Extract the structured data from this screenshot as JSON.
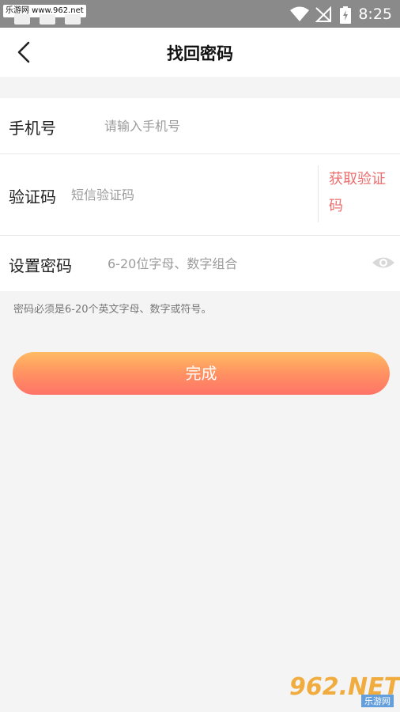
{
  "status_bar": {
    "watermark": "乐游网 www.962.net",
    "time": "8:25"
  },
  "header": {
    "title": "找回密码"
  },
  "form": {
    "phone": {
      "label": "手机号",
      "placeholder": "请输入手机号",
      "value": ""
    },
    "code": {
      "label": "验证码",
      "placeholder": "短信验证码",
      "value": "",
      "get_code": "获取验证码"
    },
    "password": {
      "label": "设置密码",
      "placeholder": "6-20位字母、数字组合",
      "value": ""
    }
  },
  "hint": "密码必须是6-20个英文字母、数字或符号。",
  "submit_label": "完成",
  "watermark_logo": {
    "main": "962.NET",
    "sub": "乐游网"
  },
  "colors": {
    "accent_red": "#ee6e6e",
    "button_gradient_start": "#ffbb63",
    "button_gradient_end": "#ff7468",
    "status_bar": "#8a8a8a"
  }
}
